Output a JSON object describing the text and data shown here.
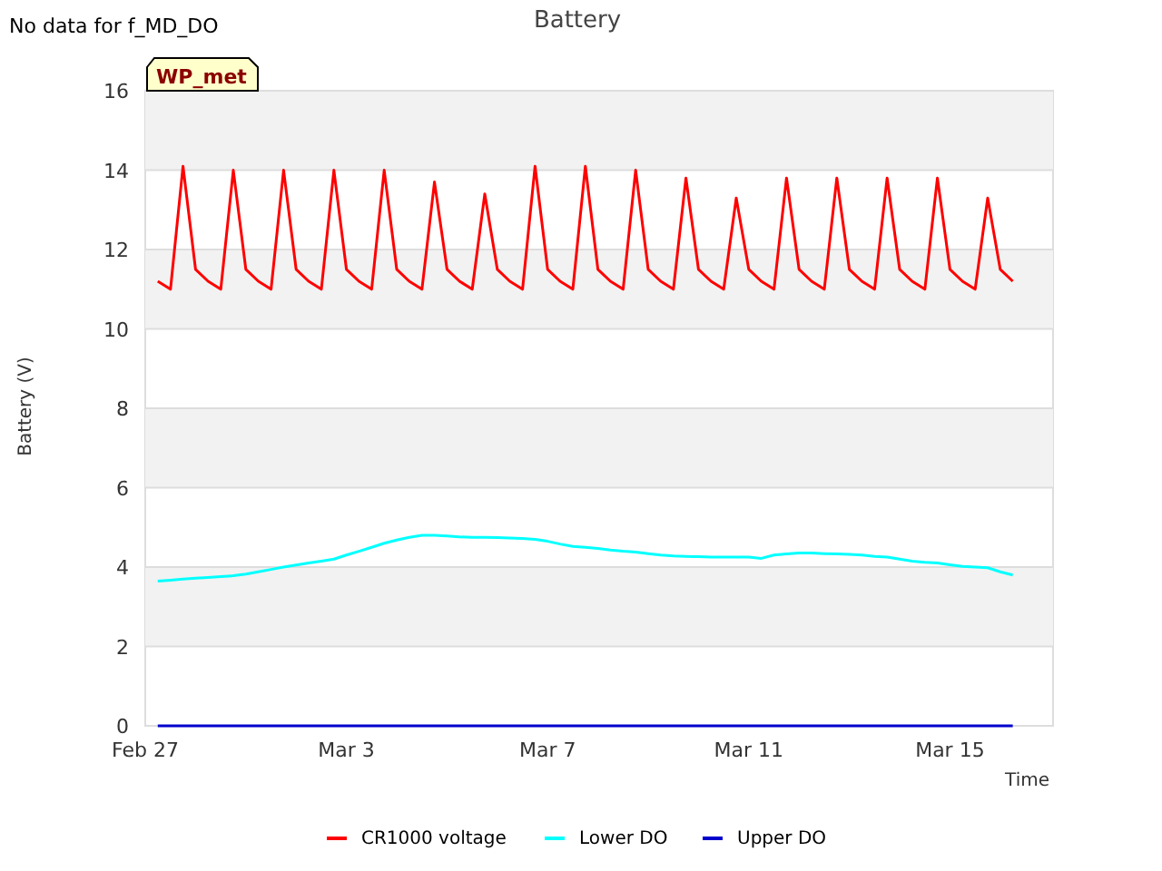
{
  "note": "No data for f_MD_DO",
  "chart": {
    "badge": "WP_met",
    "chart_data": {
      "type": "line",
      "title": "Battery",
      "xlabel": "Time",
      "ylabel": "Battery (V)",
      "categories": [
        "Feb 27",
        null,
        null,
        null,
        null,
        null,
        null,
        null,
        null,
        null,
        null,
        null,
        null,
        null,
        null,
        null,
        "Mar 3",
        null,
        null,
        null,
        null,
        null,
        null,
        null,
        null,
        null,
        null,
        null,
        null,
        null,
        null,
        null,
        "Mar 7",
        null,
        null,
        null,
        null,
        null,
        null,
        null,
        null,
        null,
        null,
        null,
        null,
        null,
        null,
        null,
        "Mar 11",
        null,
        null,
        null,
        null,
        null,
        null,
        null,
        null,
        null,
        null,
        null,
        null,
        null,
        null,
        null,
        "Mar 15",
        null,
        null,
        null,
        null,
        null
      ],
      "series": [
        {
          "name": "CR1000 voltage",
          "color": "#ff0000",
          "values": [
            null,
            11.2,
            11.0,
            14.1,
            11.5,
            11.2,
            11.0,
            14.0,
            11.5,
            11.2,
            11.0,
            14.0,
            11.5,
            11.2,
            11.0,
            14.0,
            11.5,
            11.2,
            11.0,
            14.0,
            11.5,
            11.2,
            11.0,
            13.7,
            11.5,
            11.2,
            11.0,
            13.4,
            11.5,
            11.2,
            11.0,
            14.1,
            11.5,
            11.2,
            11.0,
            14.1,
            11.5,
            11.2,
            11.0,
            14.0,
            11.5,
            11.2,
            11.0,
            13.8,
            11.5,
            11.2,
            11.0,
            13.3,
            11.5,
            11.2,
            11.0,
            13.8,
            11.5,
            11.2,
            11.0,
            13.8,
            11.5,
            11.2,
            11.0,
            13.8,
            11.5,
            11.2,
            11.0,
            13.8,
            11.5,
            11.2,
            11.0,
            13.3,
            11.5,
            11.2
          ]
        },
        {
          "name": "Lower DO",
          "color": "#00ffff",
          "values": [
            null,
            3.65,
            3.67,
            3.7,
            3.72,
            3.74,
            3.76,
            3.78,
            3.82,
            3.88,
            3.94,
            4.0,
            4.05,
            4.1,
            4.15,
            4.2,
            4.3,
            4.4,
            4.5,
            4.6,
            4.68,
            4.75,
            4.8,
            4.8,
            4.78,
            4.76,
            4.75,
            4.75,
            4.74,
            4.73,
            4.72,
            4.7,
            4.65,
            4.58,
            4.52,
            4.5,
            4.47,
            4.43,
            4.4,
            4.38,
            4.34,
            4.3,
            4.28,
            4.27,
            4.26,
            4.25,
            4.25,
            4.25,
            4.25,
            4.22,
            4.3,
            4.33,
            4.35,
            4.35,
            4.34,
            4.33,
            4.32,
            4.3,
            4.27,
            4.25,
            4.2,
            4.15,
            4.12,
            4.1,
            4.06,
            4.02,
            4.0,
            3.98,
            3.88,
            3.8
          ]
        },
        {
          "name": "Upper DO",
          "color": "#0000cd",
          "values": [
            null,
            0,
            0,
            0,
            0,
            0,
            0,
            0,
            0,
            0,
            0,
            0,
            0,
            0,
            0,
            0,
            0,
            0,
            0,
            0,
            0,
            0,
            0,
            0,
            0,
            0,
            0,
            0,
            0,
            0,
            0,
            0,
            0,
            0,
            0,
            0,
            0,
            0,
            0,
            0,
            0,
            0,
            0,
            0,
            0,
            0,
            0,
            0,
            0,
            0,
            0,
            0,
            0,
            0,
            0,
            0,
            0,
            0,
            0,
            0,
            0,
            0,
            0,
            0,
            0,
            0,
            0,
            0,
            0,
            0
          ]
        }
      ],
      "ylim": [
        0,
        16
      ],
      "grid": true,
      "legend": "bottom",
      "bands": [
        {
          "axis": "y",
          "from": 2,
          "to": 4,
          "color": "#f2f2f2"
        },
        {
          "axis": "y",
          "from": 6,
          "to": 8,
          "color": "#f2f2f2"
        },
        {
          "axis": "y",
          "from": 10,
          "to": 12,
          "color": "#f2f2f2"
        },
        {
          "axis": "y",
          "from": 14,
          "to": 16,
          "color": "#f2f2f2"
        }
      ],
      "yticks": [
        0,
        2,
        4,
        6,
        8,
        10,
        12,
        14,
        16
      ]
    }
  }
}
